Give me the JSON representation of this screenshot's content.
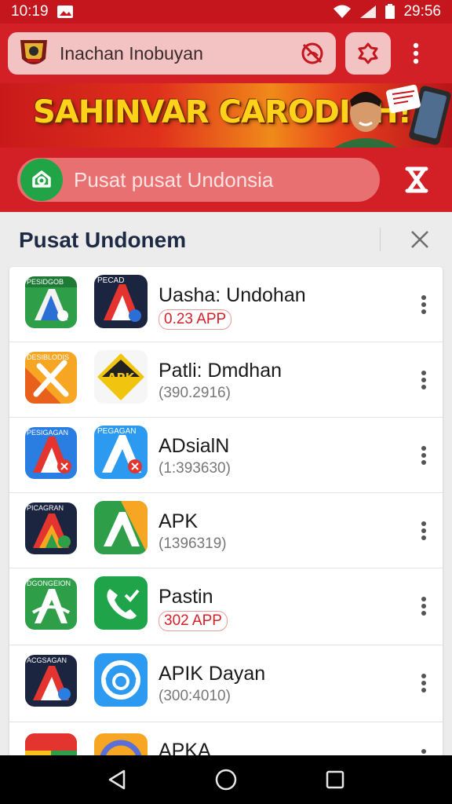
{
  "status_bar": {
    "time_left": "10:19",
    "time_right": "29:56"
  },
  "toolbar": {
    "url_text": "Inachan Inobuyan"
  },
  "banner": {
    "title": "SAHINVAR CARODICH!"
  },
  "search": {
    "text": "Pusat pusat Undonsia"
  },
  "panel": {
    "title": "Pusat Undonem",
    "items": [
      {
        "title": "Uasha: Undohan",
        "subtitle": "0.23 APP",
        "subtitle_style": "badge",
        "small_icon_label": "PESIDGOB",
        "small_icon": "a-logo-green-blue",
        "large_icon_label": "PECAD",
        "large_icon": "a-logo-dark-red"
      },
      {
        "title": "Patli: Dmdhan",
        "subtitle": "(390.2916)",
        "subtitle_style": "plain",
        "small_icon_label": "DESIBLODIS",
        "small_icon": "x-logo-orange",
        "large_icon_label": "APK",
        "large_icon": "apk-logo-yellow"
      },
      {
        "title": "ADsialN",
        "subtitle": "(1:393630)",
        "subtitle_style": "plain",
        "small_icon_label": "PESIGAGAN",
        "small_icon": "a-logo-blue-red",
        "large_icon_label": "PEGAGAN",
        "large_icon": "a-logo-blue-white"
      },
      {
        "title": "APK",
        "subtitle": "(1396319)",
        "subtitle_style": "plain",
        "small_icon_label": "PICAGRAN",
        "small_icon": "a-logo-dark-color",
        "large_icon_label": "",
        "large_icon": "a-logo-green-orange"
      },
      {
        "title": "Pastin",
        "subtitle": "302 APP",
        "subtitle_style": "badge",
        "small_icon_label": "DGONGEION",
        "small_icon": "a-logo-green",
        "large_icon_label": "",
        "large_icon": "phone-check-green"
      },
      {
        "title": "APIK Dayan",
        "subtitle": "(300:4010)",
        "subtitle_style": "plain",
        "small_icon_label": "ACGSAGAN",
        "small_icon": "a-logo-navy",
        "large_icon_label": "",
        "large_icon": "ring-blue"
      },
      {
        "title": "APKA",
        "subtitle": "",
        "subtitle_style": "plain",
        "small_icon_label": "",
        "small_icon": "multicolor",
        "large_icon_label": "",
        "large_icon": "ring-orange"
      }
    ]
  },
  "colors": {
    "brand_red": "#d32027",
    "status_red": "#c4161c",
    "search_green": "#21a446"
  }
}
